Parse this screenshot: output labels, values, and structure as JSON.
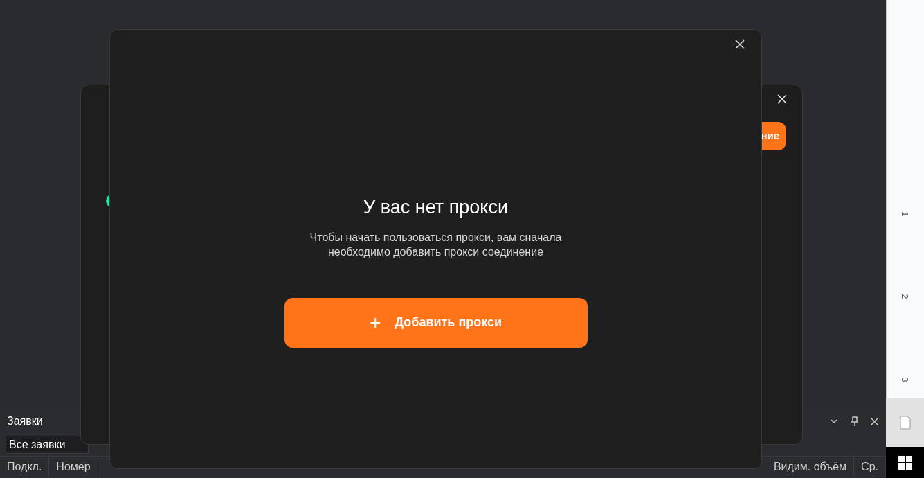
{
  "back_dialog": {
    "button_label": "ние"
  },
  "dialog": {
    "title": "У вас нет прокси",
    "message": "Чтобы начать пользоваться прокси, вам сначала необходимо добавить прокси соединение",
    "button": {
      "icon": "+",
      "label": "Добавить прокси"
    }
  },
  "panel": {
    "title": "Заявки",
    "filter": "Все заявки",
    "columns": [
      "Подкл.",
      "Номер",
      "Видим. объём",
      "Ср."
    ]
  },
  "ruler": {
    "labels": [
      "1",
      "2",
      "3"
    ]
  }
}
